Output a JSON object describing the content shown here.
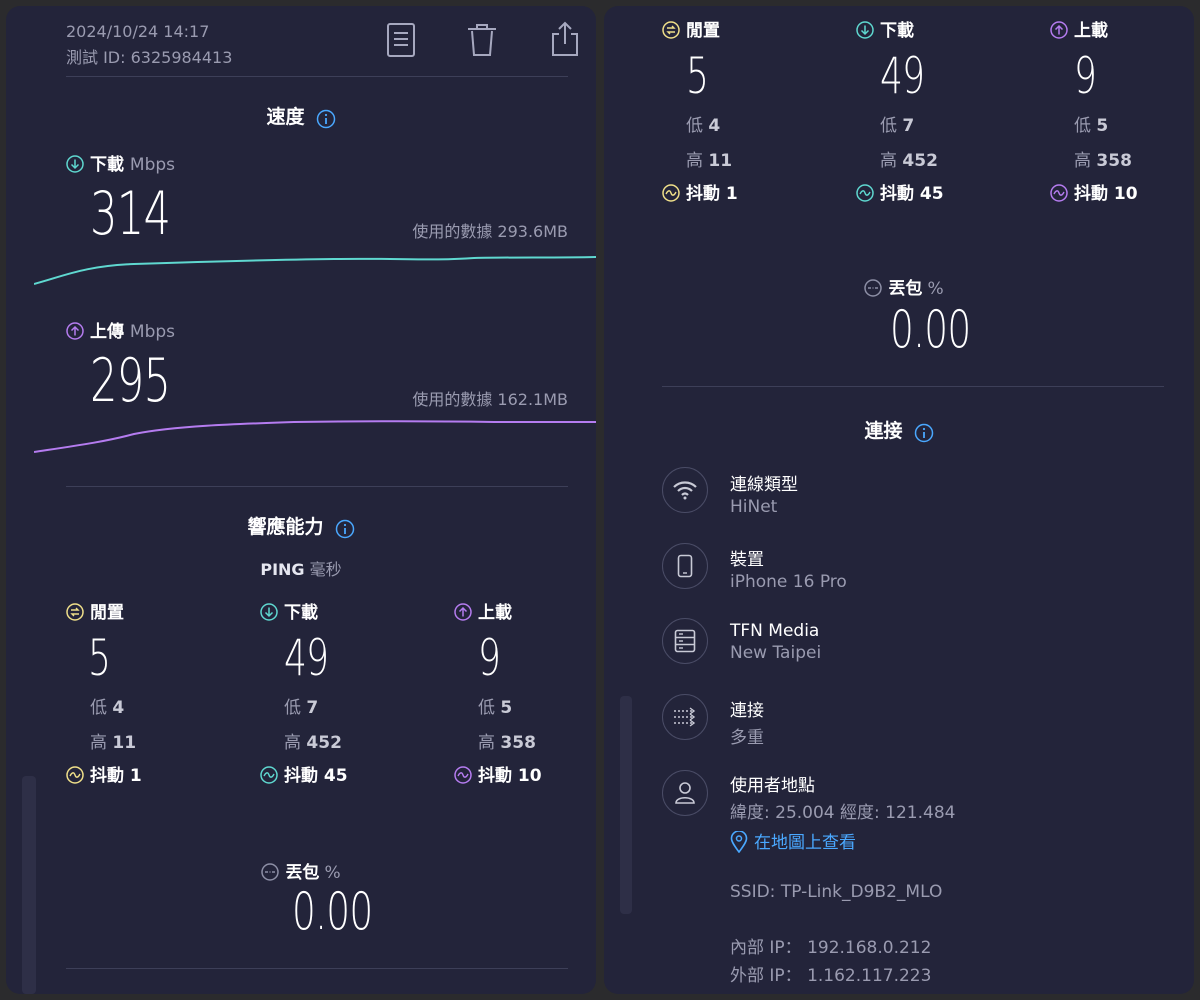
{
  "header": {
    "datetime": "2024/10/24 14:17",
    "test_id": "測試 ID: 6325984413"
  },
  "speed": {
    "title": "速度",
    "download": {
      "label": "下載",
      "unit": "Mbps",
      "value": "314",
      "data_used": "使用的數據 293.6MB"
    },
    "upload": {
      "label": "上傳",
      "unit": "Mbps",
      "value": "295",
      "data_used": "使用的數據 162.1MB"
    }
  },
  "responsiveness": {
    "title": "響應能力",
    "ping_label": "PING",
    "ping_unit": "毫秒",
    "idle": {
      "label": "閒置",
      "value": "5",
      "low_label": "低",
      "low": "4",
      "high_label": "高",
      "high": "11",
      "jitter_label": "抖動",
      "jitter": "1"
    },
    "download": {
      "label": "下載",
      "value": "49",
      "low_label": "低",
      "low": "7",
      "high_label": "高",
      "high": "452",
      "jitter_label": "抖動",
      "jitter": "45"
    },
    "upload": {
      "label": "上載",
      "value": "9",
      "low_label": "低",
      "low": "5",
      "high_label": "高",
      "high": "358",
      "jitter_label": "抖動",
      "jitter": "10"
    },
    "packet_loss": {
      "label": "丟包",
      "unit": "%",
      "value": "0.00"
    }
  },
  "connection": {
    "title": "連接",
    "items": [
      {
        "title": "連線類型",
        "subtitle": "HiNet",
        "icon": "wifi-icon"
      },
      {
        "title": "裝置",
        "subtitle": "iPhone 16 Pro",
        "icon": "phone-icon"
      },
      {
        "title": "TFN Media",
        "subtitle": "New Taipei",
        "icon": "server-icon"
      },
      {
        "title": "連接",
        "subtitle": "多重",
        "icon": "multi-connection-icon"
      },
      {
        "title": "使用者地點",
        "subtitle": "緯度: 25.004  經度: 121.484",
        "icon": "user-icon"
      }
    ],
    "map_link": "在地圖上查看",
    "ssid": "SSID: TP-Link_D9B2_MLO",
    "internal_ip": "內部 IP： 192.168.0.212",
    "external_ip": "外部 IP： 1.162.117.223"
  },
  "colors": {
    "download": "#5fd8d0",
    "upload": "#b57cf0",
    "idle": "#f0e08a",
    "link": "#4aa8ff",
    "panel": "#23243a"
  }
}
